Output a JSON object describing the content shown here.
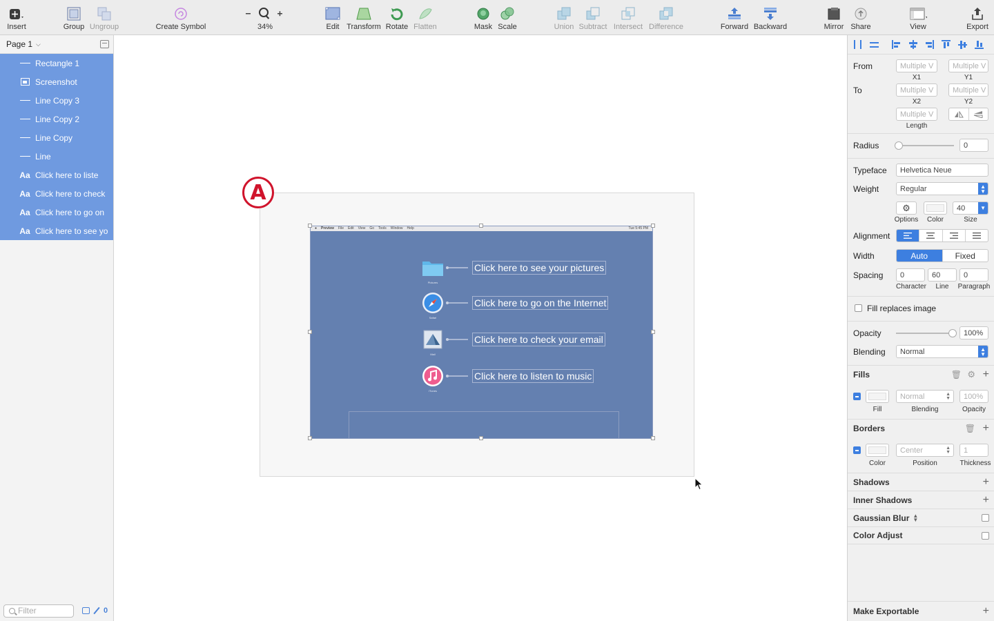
{
  "toolbar": {
    "insert": "Insert",
    "group": "Group",
    "ungroup": "Ungroup",
    "create_symbol": "Create Symbol",
    "zoom_level": "34%",
    "edit": "Edit",
    "transform": "Transform",
    "rotate": "Rotate",
    "flatten": "Flatten",
    "mask": "Mask",
    "scale": "Scale",
    "union": "Union",
    "subtract": "Subtract",
    "intersect": "Intersect",
    "difference": "Difference",
    "forward": "Forward",
    "backward": "Backward",
    "mirror": "Mirror",
    "share": "Share",
    "view": "View",
    "export": "Export"
  },
  "layers": {
    "page": "Page 1",
    "items": [
      {
        "label": "Rectangle 1",
        "icon": "line-icon"
      },
      {
        "label": "Screenshot",
        "icon": "image-icon"
      },
      {
        "label": "Line Copy 3",
        "icon": "line-icon"
      },
      {
        "label": "Line Copy 2",
        "icon": "line-icon"
      },
      {
        "label": "Line Copy",
        "icon": "line-icon"
      },
      {
        "label": "Line",
        "icon": "line-icon"
      },
      {
        "label": "Click here to liste",
        "icon": "text-icon",
        "glyph": "Aa"
      },
      {
        "label": "Click here to check",
        "icon": "text-icon",
        "glyph": "Aa"
      },
      {
        "label": "Click here to go on",
        "icon": "text-icon",
        "glyph": "Aa"
      },
      {
        "label": "Click here to see yo",
        "icon": "text-icon",
        "glyph": "Aa"
      }
    ],
    "filter_placeholder": "Filter",
    "footer_count": "0"
  },
  "canvas": {
    "badge": "A",
    "menubar": {
      "items": [
        "Preview",
        "File",
        "Edit",
        "View",
        "Go",
        "Tools",
        "Window",
        "Help"
      ],
      "clock": "Tue 5:45 PM"
    },
    "apps": [
      {
        "app": "Pictures",
        "callout": "Click here to see your pictures",
        "icon": "folder-icon"
      },
      {
        "app": "Safari",
        "callout": "Click here to go on the Internet",
        "icon": "safari-icon"
      },
      {
        "app": "Mail",
        "callout": "Click here to check your email",
        "icon": "mail-icon"
      },
      {
        "app": "iTunes",
        "callout": "Click here to listen to music",
        "icon": "itunes-icon"
      }
    ]
  },
  "inspector": {
    "from": "From",
    "to": "To",
    "x1_value": "Multiple V",
    "y1_value": "Multiple V",
    "x2_value": "Multiple V",
    "y2_value": "Multiple V",
    "length_value": "Multiple V",
    "x1": "X1",
    "y1": "Y1",
    "x2": "X2",
    "y2": "Y2",
    "length": "Length",
    "radius": "Radius",
    "radius_value": "0",
    "radius_fraction": 0.0,
    "typeface": "Typeface",
    "typeface_value": "Helvetica Neue",
    "weight": "Weight",
    "weight_value": "Regular",
    "options": "Options",
    "color": "Color",
    "size": "Size",
    "size_value": "40",
    "alignment": "Alignment",
    "width": "Width",
    "width_auto": "Auto",
    "width_fixed": "Fixed",
    "spacing": "Spacing",
    "character_value": "0",
    "line_value": "60",
    "paragraph_value": "0",
    "character": "Character",
    "line": "Line",
    "paragraph": "Paragraph",
    "fill_replaces_image": "Fill replaces image",
    "opacity": "Opacity",
    "opacity_value": "100%",
    "opacity_fraction": 1.0,
    "blending": "Blending",
    "blending_value": "Normal",
    "fills": "Fills",
    "fill_blending_value": "Normal",
    "fill_opacity_value": "100%",
    "fill": "Fill",
    "blending_sub": "Blending",
    "opacity_sub": "Opacity",
    "borders": "Borders",
    "border_position_value": "Center",
    "border_thickness_value": "1",
    "color_sub": "Color",
    "position_sub": "Position",
    "thickness_sub": "Thickness",
    "shadows": "Shadows",
    "inner_shadows": "Inner Shadows",
    "gaussian_blur": "Gaussian Blur",
    "color_adjust": "Color Adjust",
    "make_exportable": "Make Exportable"
  },
  "colors": {
    "accent": "#3d7fe0",
    "selection": "#6f9ae0",
    "badge": "#d0142c",
    "screenshot_bg": "#6480b0"
  }
}
